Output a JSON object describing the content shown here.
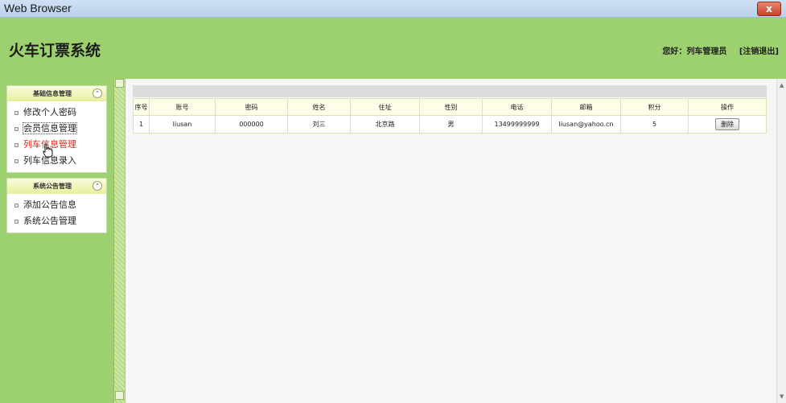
{
  "window": {
    "title": "Web Browser",
    "close_label": "x"
  },
  "header": {
    "app_title": "火车订票系统",
    "greeting": "您好：列车管理员",
    "logout_label": "[注销退出]"
  },
  "sidebar": {
    "panels": [
      {
        "title": "基础信息管理",
        "toggle": "⌃",
        "items": [
          {
            "label": "修改个人密码"
          },
          {
            "label": "会员信息管理"
          },
          {
            "label": "列车信息管理"
          },
          {
            "label": "列车信息录入"
          }
        ]
      },
      {
        "title": "系统公告管理",
        "toggle": "⌃",
        "items": [
          {
            "label": "添加公告信息"
          },
          {
            "label": "系统公告管理"
          }
        ]
      }
    ]
  },
  "table": {
    "columns": [
      "序号",
      "账号",
      "密码",
      "姓名",
      "住址",
      "性别",
      "电话",
      "邮箱",
      "积分",
      "操作"
    ],
    "rows": [
      {
        "index": "1",
        "account": "liusan",
        "password": "000000",
        "name": "刘三",
        "address": "北京路",
        "gender": "男",
        "phone": "13499999999",
        "email": "liusan@yahoo.cn",
        "points": "5",
        "action": "删除"
      }
    ]
  },
  "colors": {
    "accent": "#9dd16f",
    "active_menu": "#d9261c"
  },
  "scrollbar": {
    "up_arrow": "▲",
    "down_arrow": "▼"
  }
}
